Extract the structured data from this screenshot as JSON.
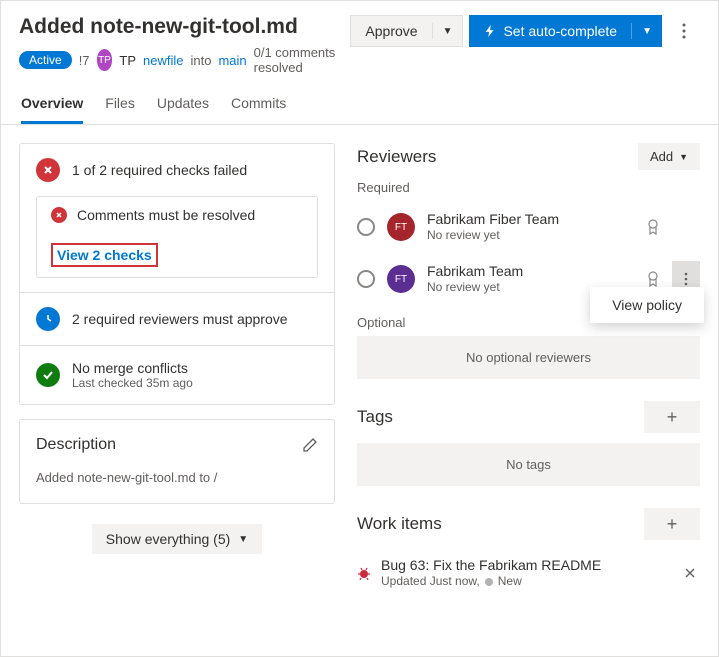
{
  "header": {
    "title": "Added note-new-git-tool.md",
    "status": "Active",
    "pr_id": "!7",
    "author_initials": "TP",
    "author_short": "TP",
    "source_branch": "newfile",
    "into": "into",
    "target_branch": "main",
    "comments_resolved": "0/1 comments resolved",
    "approve_label": "Approve",
    "autocomplete_label": "Set auto-complete"
  },
  "tabs": [
    {
      "label": "Overview"
    },
    {
      "label": "Files"
    },
    {
      "label": "Updates"
    },
    {
      "label": "Commits"
    }
  ],
  "checks": {
    "summary": "1 of 2 required checks failed",
    "comment_check": "Comments must be resolved",
    "view_link": "View 2 checks",
    "reviewers_required": "2 required reviewers must approve",
    "no_conflicts": "No merge conflicts",
    "last_checked": "Last checked 35m ago"
  },
  "description": {
    "heading": "Description",
    "body": "Added note-new-git-tool.md to /"
  },
  "reviewers": {
    "heading": "Reviewers",
    "add_label": "Add",
    "required_label": "Required",
    "optional_label": "Optional",
    "no_review": "No review yet",
    "no_optional": "No optional reviewers",
    "items": [
      {
        "name": "Fabrikam Fiber Team",
        "initials": "FT"
      },
      {
        "name": "Fabrikam Team",
        "initials": "FT"
      }
    ],
    "popup": "View policy"
  },
  "tags": {
    "heading": "Tags",
    "empty": "No tags"
  },
  "workitems": {
    "heading": "Work items",
    "item": {
      "title": "Bug 63: Fix the Fabrikam README",
      "updated": "Updated Just now,",
      "state": "New"
    }
  },
  "footer": {
    "show_label": "Show everything (5)"
  }
}
